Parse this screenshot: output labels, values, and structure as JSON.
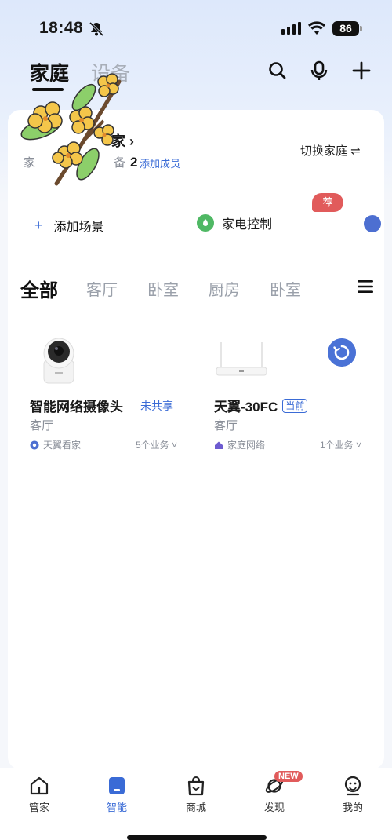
{
  "status_bar": {
    "time": "18:48",
    "battery": "86"
  },
  "header": {
    "tabs": [
      {
        "label": "家庭"
      },
      {
        "label": "设备"
      }
    ]
  },
  "home": {
    "name": "家 ›",
    "meta_prefix": "家",
    "meta_device_label": "备",
    "device_count": "2",
    "add_member": "添加成员",
    "switch_home": "切换家庭 ⇌"
  },
  "scenes": {
    "recommend_badge": "荐",
    "add_scene": "添加场景",
    "appliance_control": "家电控制"
  },
  "rooms": [
    "全部",
    "客厅",
    "卧室",
    "厨房",
    "卧室"
  ],
  "devices": [
    {
      "name": "智能网络摄像头",
      "tag": "未共享",
      "room": "客厅",
      "source": "天翼看家",
      "business": "5个业务 ˅"
    },
    {
      "name": "天翼-30FC",
      "tag": "当前",
      "room": "客厅",
      "source": "家庭网络",
      "business": "1个业务 ˅"
    }
  ],
  "bottom_nav": [
    {
      "label": "管家"
    },
    {
      "label": "智能"
    },
    {
      "label": "商城"
    },
    {
      "label": "发现",
      "badge": "NEW"
    },
    {
      "label": "我的"
    }
  ],
  "colors": {
    "accent": "#3a6bd6",
    "badge_red": "#e15b5b",
    "green": "#4fb864"
  }
}
